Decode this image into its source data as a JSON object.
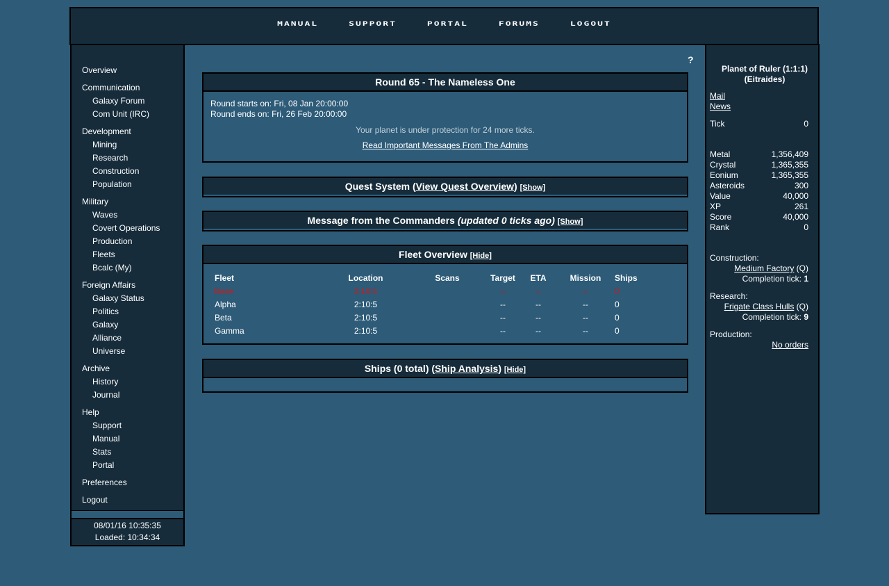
{
  "topnav": [
    "MANUAL",
    "SUPPORT",
    "PORTAL",
    "FORUMS",
    "LOGOUT"
  ],
  "menu": [
    {
      "head": "Overview",
      "subs": []
    },
    {
      "head": "Communication",
      "subs": [
        "Galaxy Forum",
        "Com Unit (IRC)"
      ]
    },
    {
      "head": "Development",
      "subs": [
        "Mining",
        "Research",
        "Construction",
        "Population"
      ]
    },
    {
      "head": "Military",
      "subs": [
        "Waves",
        "Covert Operations",
        "Production",
        "Fleets",
        "Bcalc (My)"
      ]
    },
    {
      "head": "Foreign Affairs",
      "subs": [
        "Galaxy Status",
        "Politics",
        "Galaxy",
        "Alliance",
        "Universe"
      ]
    },
    {
      "head": "Archive",
      "subs": [
        "History",
        "Journal"
      ]
    },
    {
      "head": "Help",
      "subs": [
        "Support",
        "Manual",
        "Stats",
        "Portal"
      ]
    },
    {
      "head": "Preferences",
      "subs": []
    },
    {
      "head": "Logout",
      "subs": []
    }
  ],
  "clock": {
    "now": "08/01/16 10:35:35",
    "loaded": "Loaded: 10:34:34"
  },
  "help_icon": "?",
  "round": {
    "title": "Round 65 - The Nameless One",
    "starts": "Round starts on: Fri, 08 Jan 20:00:00",
    "ends": "Round ends on: Fri, 26 Feb 20:00:00",
    "protection": "Your planet is under protection for 24 more ticks.",
    "admin_link": "Read Important Messages From The Admins"
  },
  "quest": {
    "prefix": "Quest System (",
    "link": "View Quest Overview",
    "suffix": ")",
    "toggle": "[Show]"
  },
  "commanders": {
    "title": "Message from the Commanders",
    "updated": "(updated 0 ticks ago)",
    "toggle": "[Show]"
  },
  "fleet_overview": {
    "title": "Fleet Overview",
    "toggle": "[Hide]",
    "columns": [
      "Fleet",
      "Location",
      "Scans",
      "Target",
      "ETA",
      "Mission",
      "Ships"
    ],
    "rows": [
      {
        "fleet": "Base",
        "location": "2:10:5",
        "scans": "",
        "target": "--",
        "eta": "--",
        "mission": "--",
        "ships": "0",
        "highlight": true
      },
      {
        "fleet": "Alpha",
        "location": "2:10:5",
        "scans": "",
        "target": "--",
        "eta": "--",
        "mission": "--",
        "ships": "0",
        "highlight": false
      },
      {
        "fleet": "Beta",
        "location": "2:10:5",
        "scans": "",
        "target": "--",
        "eta": "--",
        "mission": "--",
        "ships": "0",
        "highlight": false
      },
      {
        "fleet": "Gamma",
        "location": "2:10:5",
        "scans": "",
        "target": "--",
        "eta": "--",
        "mission": "--",
        "ships": "0",
        "highlight": false
      }
    ]
  },
  "ships": {
    "prefix": "Ships (0 total) (",
    "link": "Ship Analysis",
    "suffix": ")",
    "toggle": "[Hide]"
  },
  "planet": {
    "name": "Planet of Ruler (1:1:1)",
    "race": "(Eitraides)",
    "mail": "Mail",
    "news": "News",
    "tick_label": "Tick",
    "tick_value": "0",
    "stats": [
      {
        "label": "Metal",
        "value": "1,356,409"
      },
      {
        "label": "Crystal",
        "value": "1,365,355"
      },
      {
        "label": "Eonium",
        "value": "1,365,355"
      },
      {
        "label": "Asteroids",
        "value": "300"
      },
      {
        "label": "Value",
        "value": "40,000"
      },
      {
        "label": "XP",
        "value": "261"
      },
      {
        "label": "Score",
        "value": "40,000"
      },
      {
        "label": "Rank",
        "value": "0"
      }
    ],
    "construction_label": "Construction:",
    "construction_item": "Medium Factory",
    "construction_q": " (Q)",
    "construction_tick_label": "Completion tick: ",
    "construction_tick": "1",
    "research_label": "Research:",
    "research_item": "Frigate Class Hulls",
    "research_q": " (Q)",
    "research_tick_label": "Completion tick: ",
    "research_tick": "9",
    "production_label": "Production:",
    "production_value": "No orders"
  }
}
